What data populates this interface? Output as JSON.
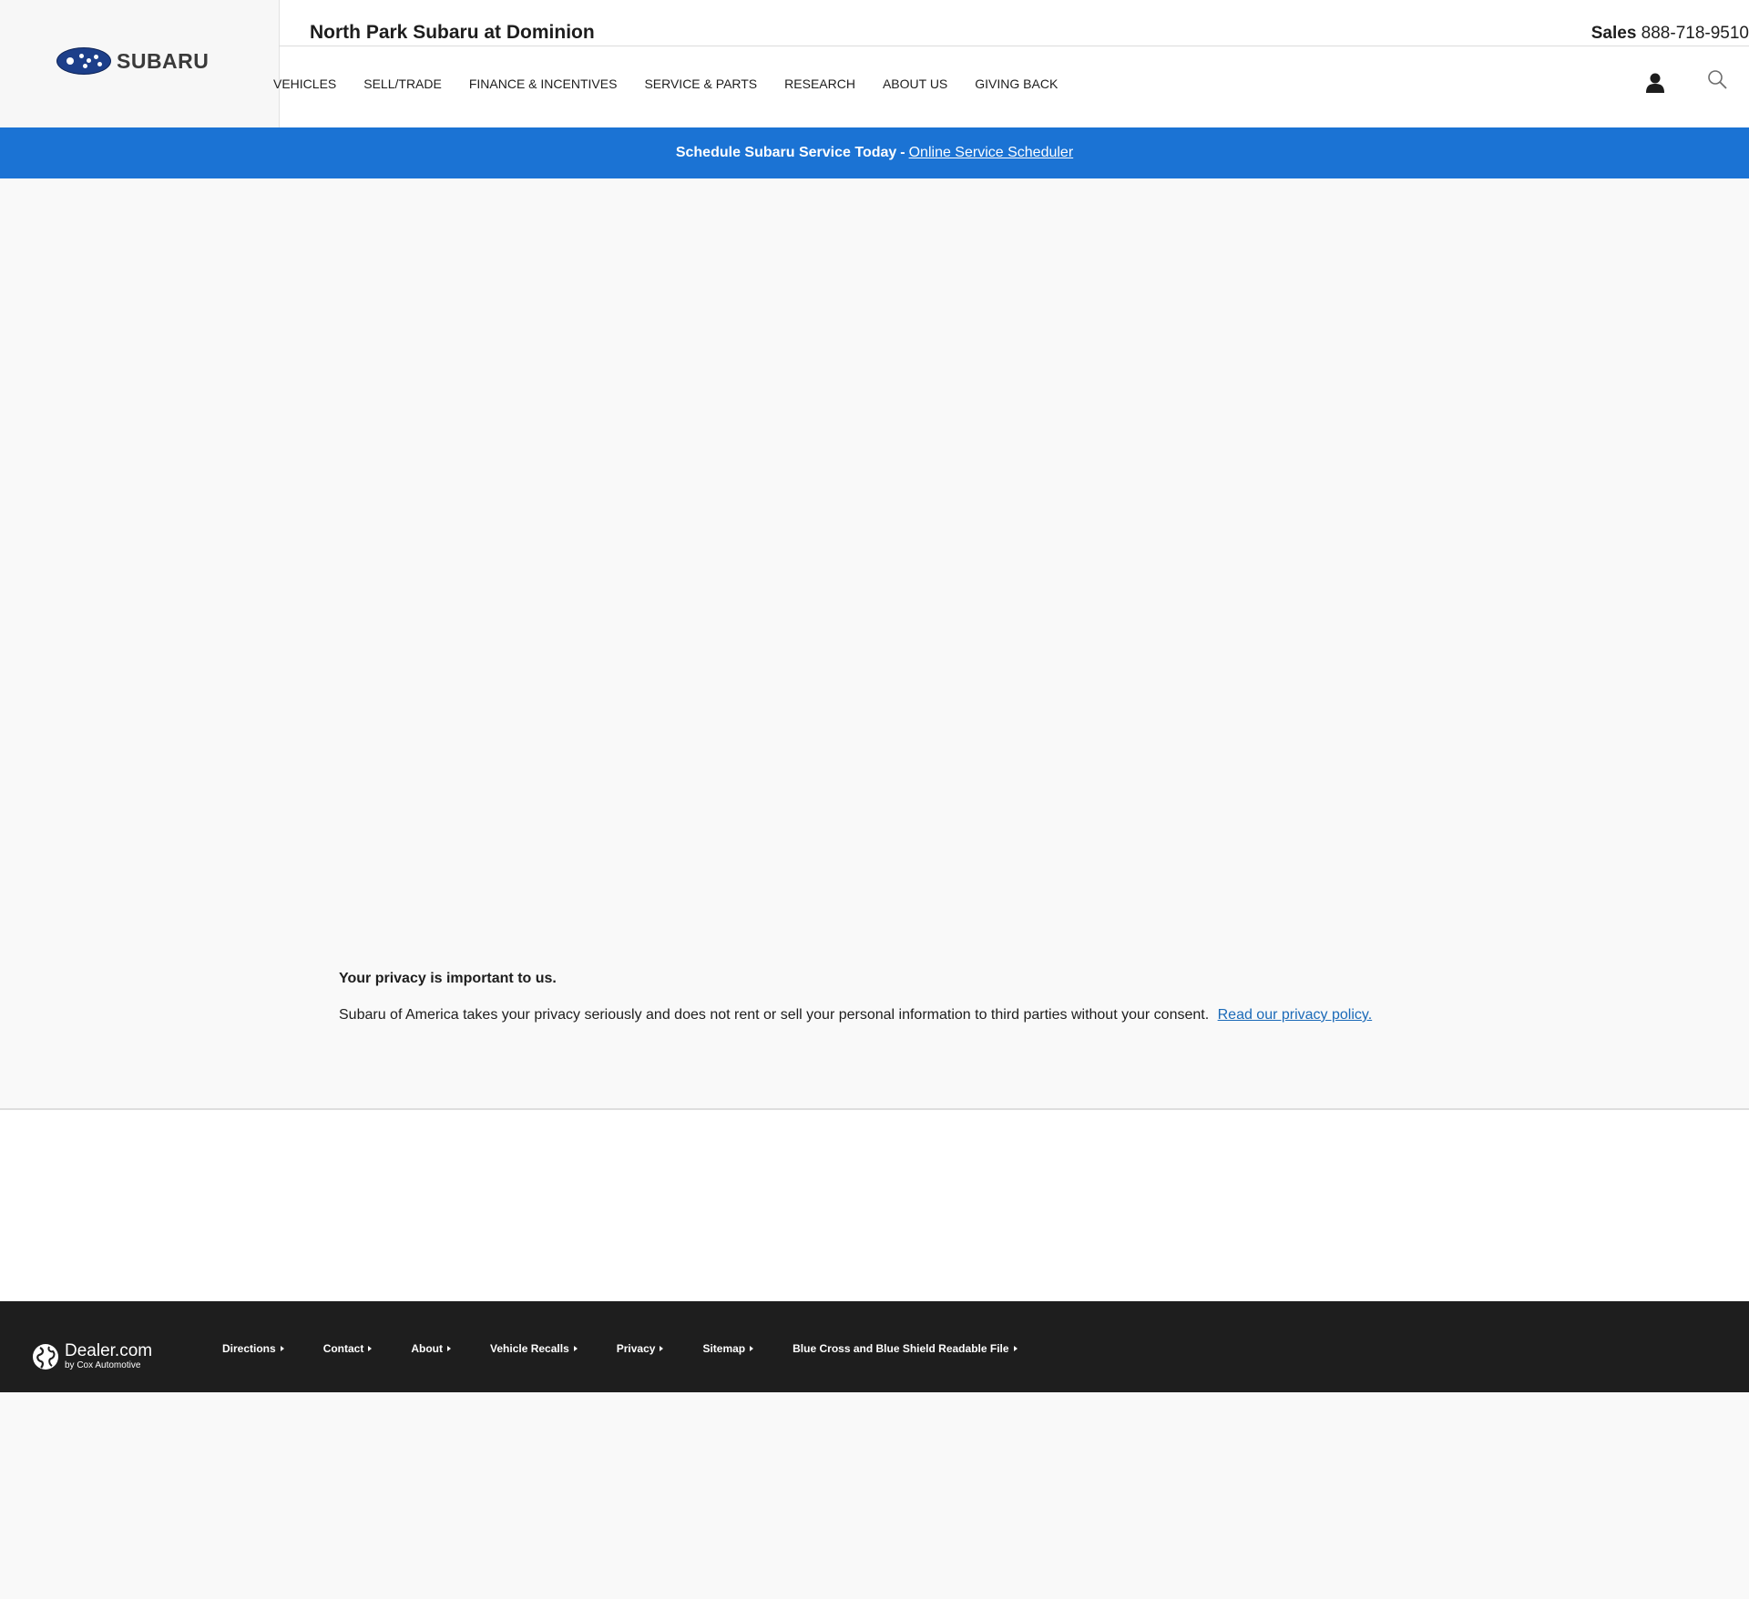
{
  "header": {
    "brand": "SUBARU",
    "dealer_name": "North Park Subaru at Dominion",
    "sales_label": "Sales",
    "sales_phone": "888-718-9510",
    "nav": [
      "VEHICLES",
      "SELL/TRADE",
      "FINANCE & INCENTIVES",
      "SERVICE & PARTS",
      "RESEARCH",
      "ABOUT US",
      "GIVING BACK"
    ],
    "icons": [
      "user-icon",
      "search-icon"
    ]
  },
  "banner": {
    "text": "Schedule Subaru Service Today",
    "separator": "-",
    "link": "Online Service Scheduler",
    "color": "#1b73d4"
  },
  "privacy": {
    "title": "Your privacy is important to us.",
    "text": "Subaru of America takes your privacy seriously and does not rent or sell your personal information to third parties without your consent.",
    "link": "Read our privacy policy."
  },
  "footer": {
    "brand": "Dealer.com",
    "brand_sub": "by Cox Automotive",
    "links": [
      "Directions",
      "Contact",
      "About",
      "Vehicle Recalls",
      "Privacy",
      "Sitemap",
      "Blue Cross and Blue Shield Readable File"
    ],
    "background": "#1e1e1e"
  }
}
